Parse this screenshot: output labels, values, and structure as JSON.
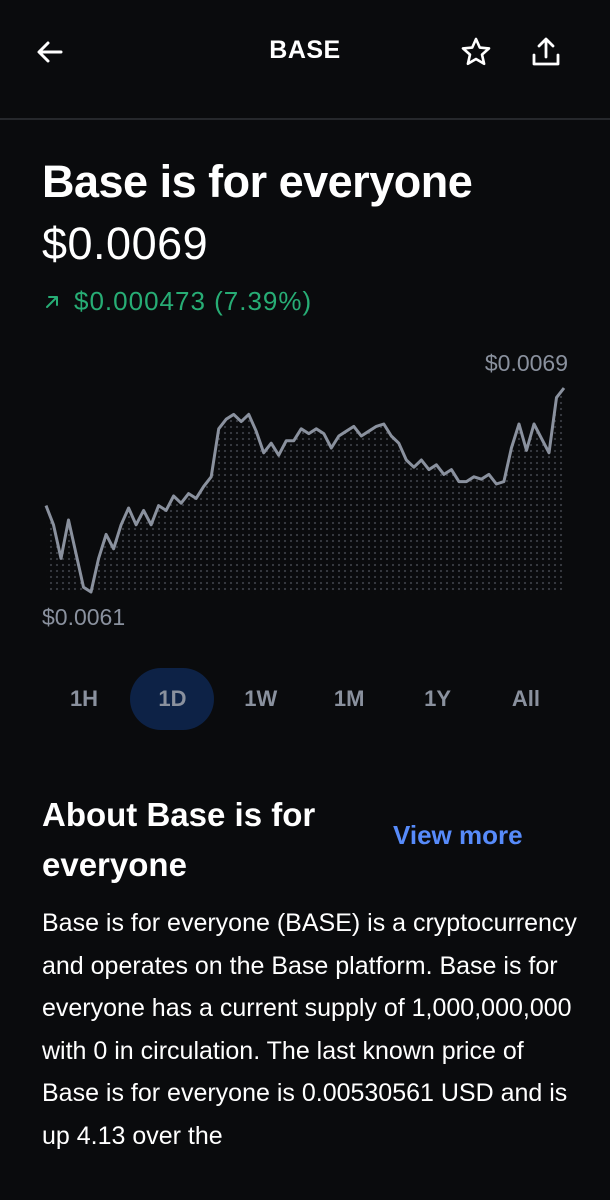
{
  "header": {
    "title": "BASE",
    "back_icon": "arrow-left-icon",
    "favorite_icon": "star-icon",
    "share_icon": "share-icon"
  },
  "asset": {
    "name": "Base is for everyone",
    "price": "$0.0069",
    "change_text": "$0.000473 (7.39%)",
    "change_direction": "up",
    "change_color": "#27ad75"
  },
  "chart_data": {
    "type": "line",
    "high_label": "$0.0069",
    "low_label": "$0.0061",
    "y": [
      0.00648,
      0.0064,
      0.00626,
      0.00642,
      0.00628,
      0.00614,
      0.00612,
      0.00626,
      0.00636,
      0.0063,
      0.0064,
      0.00647,
      0.0064,
      0.00646,
      0.0064,
      0.00648,
      0.00646,
      0.00652,
      0.00649,
      0.00653,
      0.00651,
      0.00656,
      0.0066,
      0.0068,
      0.00684,
      0.00686,
      0.00683,
      0.00686,
      0.00679,
      0.0067,
      0.00674,
      0.00669,
      0.00675,
      0.00675,
      0.0068,
      0.00678,
      0.0068,
      0.00678,
      0.00672,
      0.00677,
      0.00679,
      0.00681,
      0.00677,
      0.00679,
      0.00681,
      0.00682,
      0.00677,
      0.00674,
      0.00667,
      0.00664,
      0.00667,
      0.00663,
      0.00665,
      0.00661,
      0.00663,
      0.00658,
      0.00658,
      0.0066,
      0.00659,
      0.00661,
      0.00657,
      0.00658,
      0.00672,
      0.00682,
      0.00671,
      0.00682,
      0.00676,
      0.0067,
      0.00693,
      0.00697
    ],
    "color": "#8a919e",
    "selected_range": "1D"
  },
  "ranges": [
    "1H",
    "1D",
    "1W",
    "1M",
    "1Y",
    "All"
  ],
  "about": {
    "title": "About Base is for everyone",
    "view_more": "View more",
    "description": "Base is for everyone (BASE) is a cryptocurrency and operates on the Base platform. Base is for everyone has a current supply of 1,000,000,000 with 0 in circulation. The last known price of Base is for everyone is 0.00530561 USD and is up 4.13 over the"
  },
  "colors": {
    "background": "#0a0b0d",
    "accent": "#578bfa",
    "active_range_bg": "#0d2246",
    "muted": "#8a919e"
  }
}
